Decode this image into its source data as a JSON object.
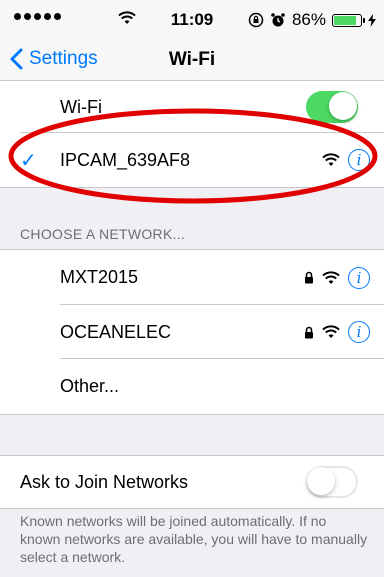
{
  "status_bar": {
    "time": "11:09",
    "battery": "86%",
    "battery_level": 0.86
  },
  "nav": {
    "back_label": "Settings",
    "title": "Wi-Fi"
  },
  "wifi_toggle": {
    "label": "Wi-Fi",
    "enabled": true
  },
  "connected_network": {
    "name": "IPCAM_639AF8"
  },
  "choose_section": {
    "header": "CHOOSE A NETWORK...",
    "networks": [
      {
        "name": "MXT2015",
        "locked": true
      },
      {
        "name": "OCEANELEC",
        "locked": true
      }
    ],
    "other_label": "Other..."
  },
  "ask_to_join": {
    "label": "Ask to Join Networks",
    "enabled": false,
    "note": "Known networks will be joined automatically. If no known networks are available, you will have to manually select a network."
  },
  "colors": {
    "accent": "#007aff",
    "toggle_on": "#4cd964",
    "annotation": "#e00000"
  }
}
